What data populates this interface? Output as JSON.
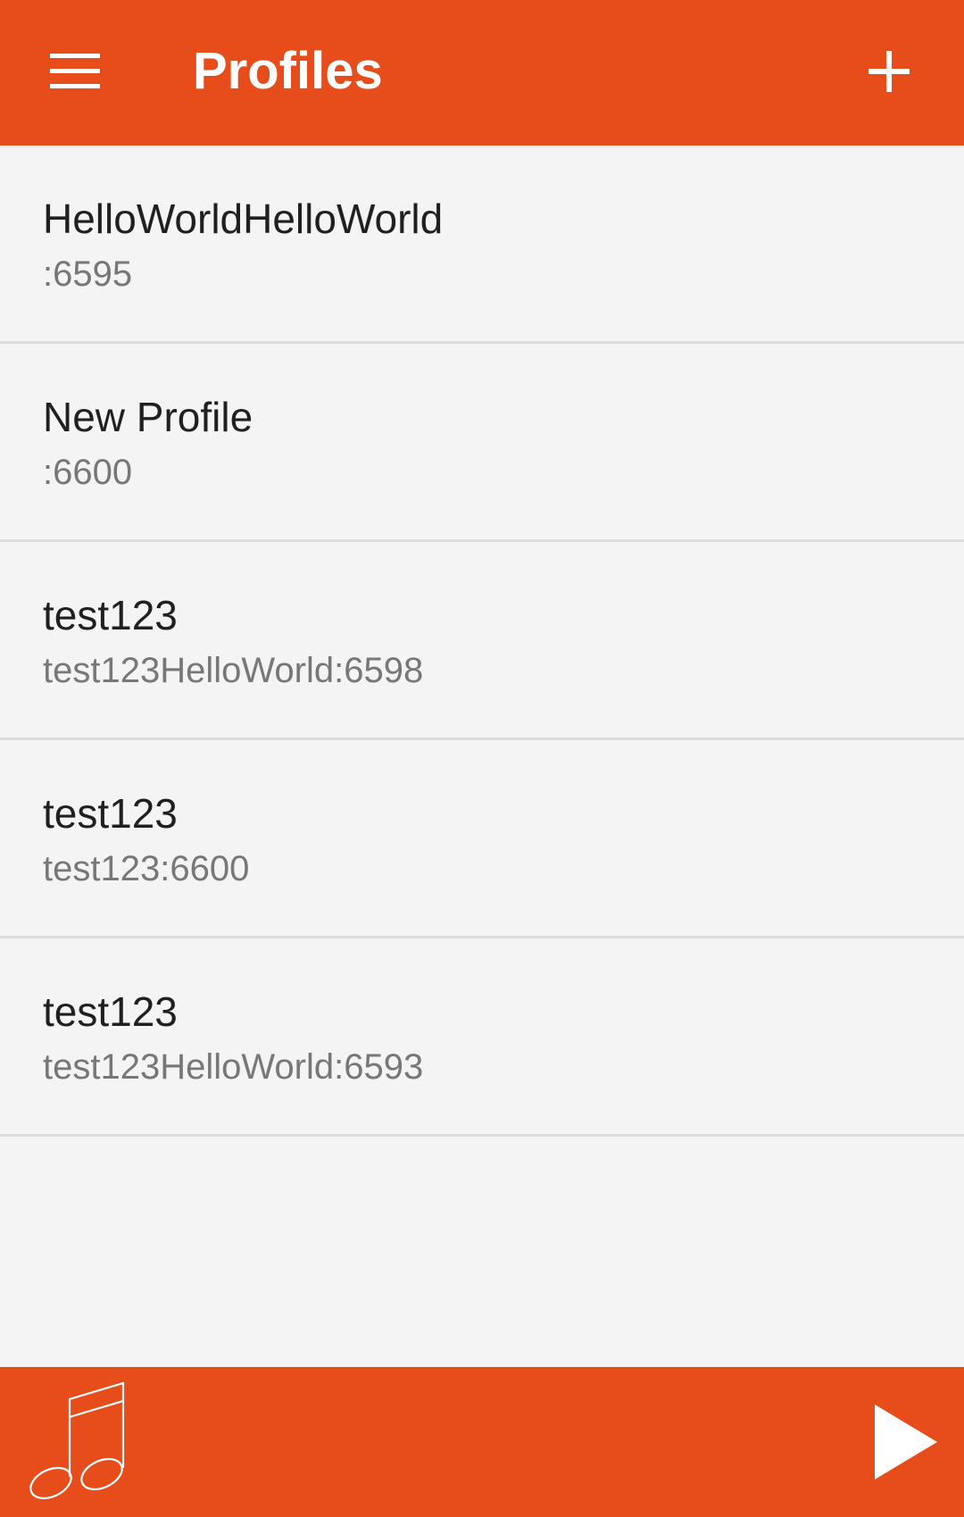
{
  "app_bar": {
    "title": "Profiles",
    "background": "#e74c1b",
    "menu_icon": "hamburger-menu-icon",
    "add_icon": "plus-icon"
  },
  "profiles": [
    {
      "name": "HelloWorldHelloWorld",
      "detail": ":6595"
    },
    {
      "name": "New Profile",
      "detail": ":6600"
    },
    {
      "name": "test123",
      "detail": "test123HelloWorld:6598"
    },
    {
      "name": "test123",
      "detail": "test123:6600"
    },
    {
      "name": "test123",
      "detail": "test123HelloWorld:6593"
    }
  ],
  "bottom_bar": {
    "left_icon": "music-note-icon",
    "right_icon": "play-icon"
  }
}
